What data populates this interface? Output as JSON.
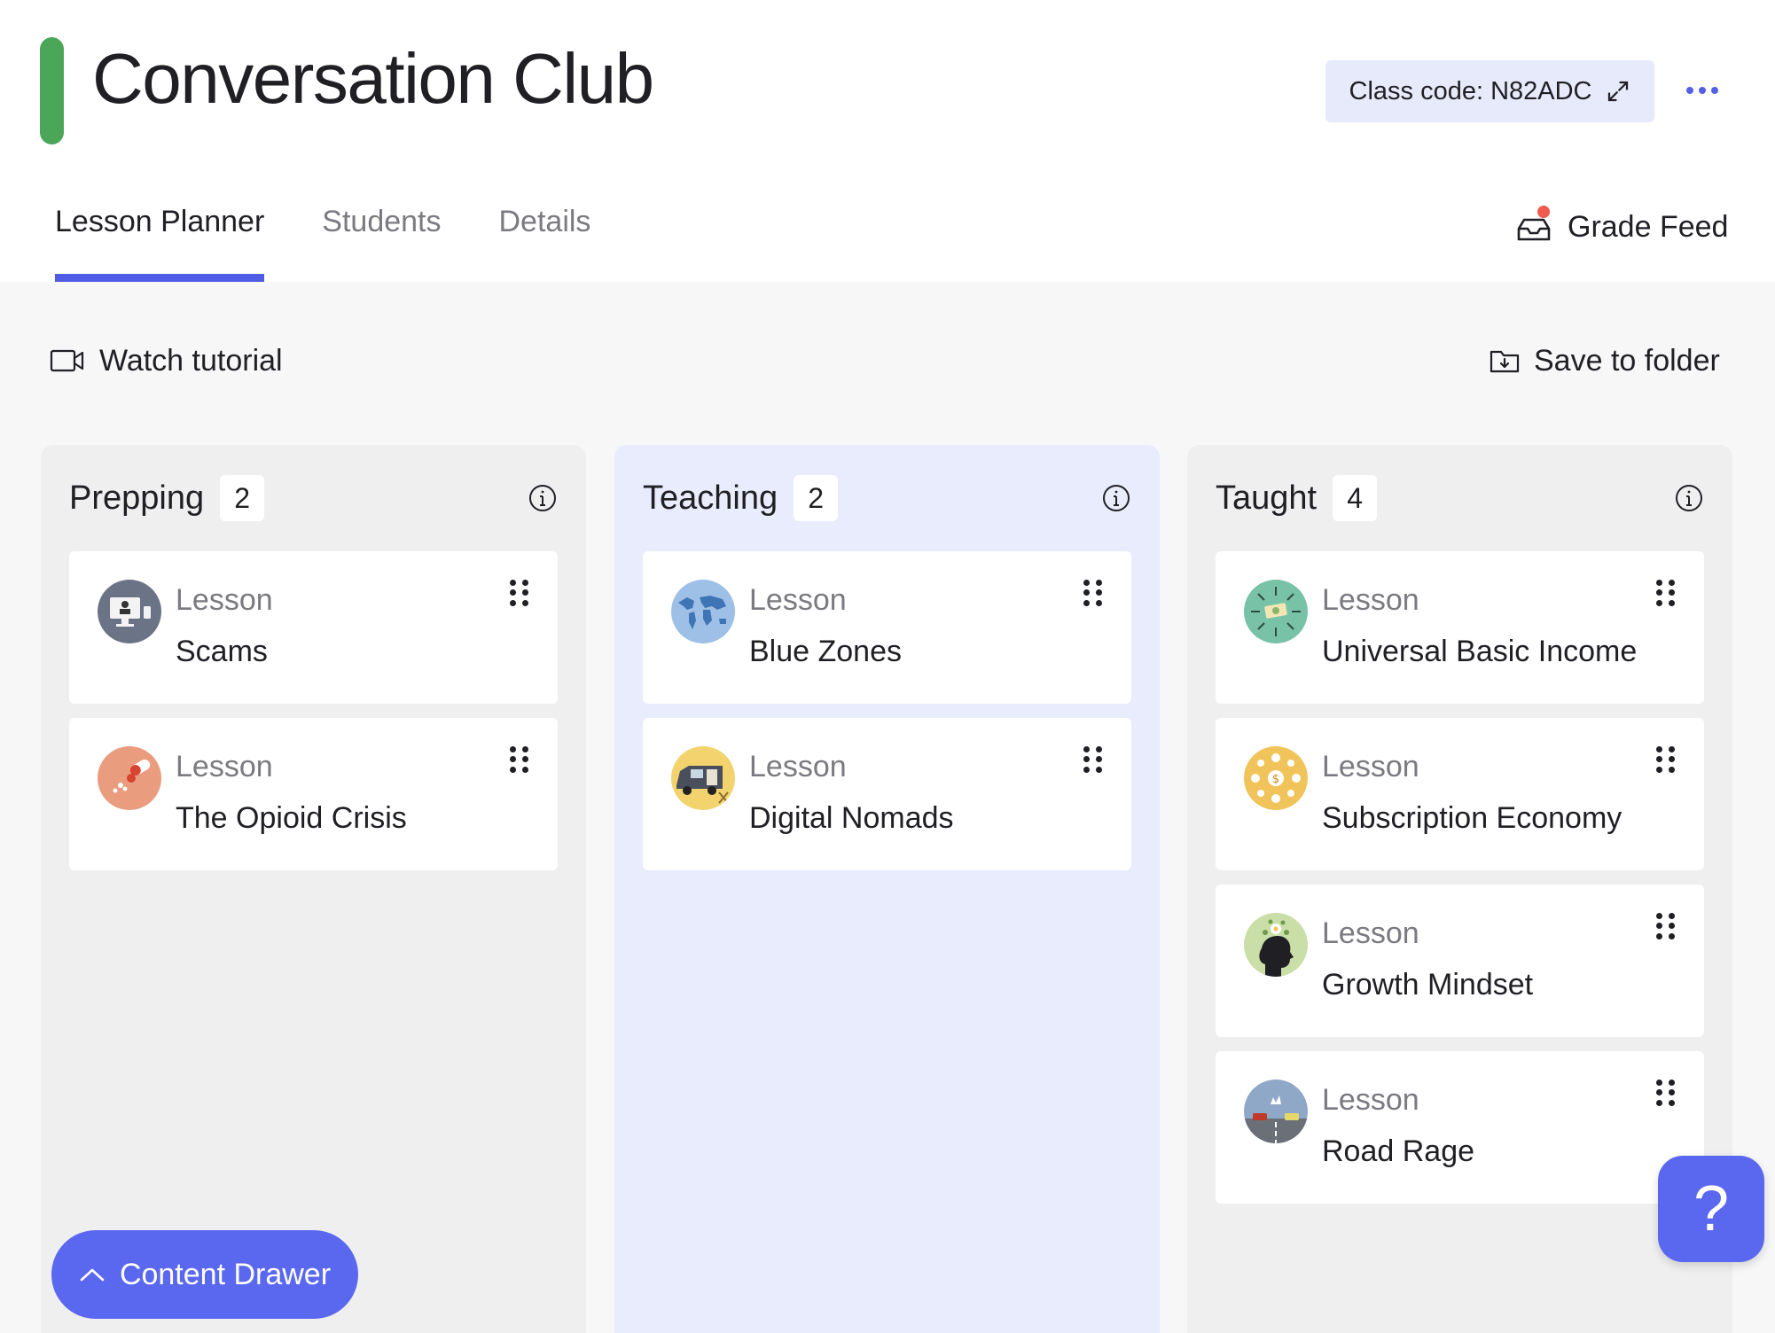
{
  "header": {
    "title": "Conversation Club",
    "class_code": "Class code: N82ADC",
    "tabs": [
      {
        "label": "Lesson Planner",
        "active": true
      },
      {
        "label": "Students",
        "active": false
      },
      {
        "label": "Details",
        "active": false
      }
    ],
    "grade_feed": "Grade Feed"
  },
  "toolbar": {
    "watch_tutorial": "Watch tutorial",
    "save_to_folder": "Save to folder"
  },
  "columns": [
    {
      "title": "Prepping",
      "count": "2",
      "cards": [
        {
          "kind": "Lesson",
          "name": "Scams",
          "thumb_icon": "computer-scam-icon",
          "thumb_color": "#6b7386"
        },
        {
          "kind": "Lesson",
          "name": "The Opioid Crisis",
          "thumb_icon": "pills-icon",
          "thumb_color": "#e99c7e"
        }
      ]
    },
    {
      "title": "Teaching",
      "count": "2",
      "cards": [
        {
          "kind": "Lesson",
          "name": "Blue Zones",
          "thumb_icon": "world-map-icon",
          "thumb_color": "#9ec0e6"
        },
        {
          "kind": "Lesson",
          "name": "Digital Nomads",
          "thumb_icon": "camper-van-icon",
          "thumb_color": "#f3d36d"
        }
      ]
    },
    {
      "title": "Taught",
      "count": "4",
      "cards": [
        {
          "kind": "Lesson",
          "name": "Universal Basic Income",
          "thumb_icon": "money-icon",
          "thumb_color": "#78c3a8"
        },
        {
          "kind": "Lesson",
          "name": "Subscription Economy",
          "thumb_icon": "dollar-network-icon",
          "thumb_color": "#f1c45b"
        },
        {
          "kind": "Lesson",
          "name": "Growth Mindset",
          "thumb_icon": "head-flowers-icon",
          "thumb_color": "#c9dfa7"
        },
        {
          "kind": "Lesson",
          "name": "Road Rage",
          "thumb_icon": "cars-road-icon",
          "thumb_color": "#90a8c8"
        }
      ]
    }
  ],
  "content_drawer": "Content Drawer",
  "help": "?",
  "colors": {
    "accent": "#5a67ef",
    "title_bar": "#4ca65a",
    "teaching_column": "#e8ecfc",
    "notification_dot": "#f05a4f"
  }
}
